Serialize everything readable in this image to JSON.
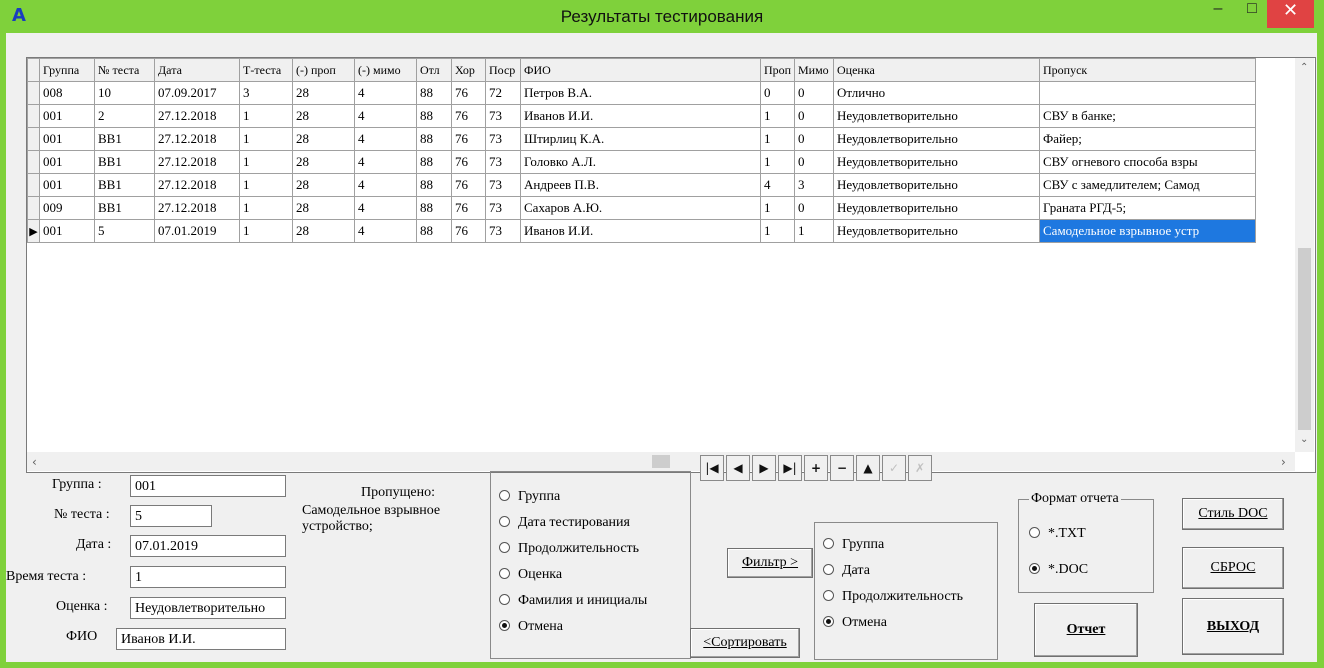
{
  "window": {
    "title": "Результаты тестирования",
    "icon": "app-logo-icon",
    "minimize": "–",
    "maximize": "□",
    "close": "✕"
  },
  "grid": {
    "columns": [
      "Группа",
      "№ теста",
      "Дата",
      "Т-теста",
      "(-) проп",
      "(-) мимо",
      "Отл",
      "Хор",
      "Поср",
      "ФИО",
      "Проп",
      "Мимо",
      "Оценка",
      "Пропуск"
    ],
    "rows": [
      [
        "008",
        "10",
        "07.09.2017",
        "3",
        "28",
        "4",
        "88",
        "76",
        "72",
        "Петров В.А.",
        "0",
        "0",
        "Отлично",
        ""
      ],
      [
        "001",
        "2",
        "27.12.2018",
        "1",
        "28",
        "4",
        "88",
        "76",
        "73",
        "Иванов И.И.",
        "1",
        "0",
        "Неудовлетворительно",
        "СВУ в банке;"
      ],
      [
        "001",
        "BB1",
        "27.12.2018",
        "1",
        "28",
        "4",
        "88",
        "76",
        "73",
        "Штирлиц К.А.",
        "1",
        "0",
        "Неудовлетворительно",
        "Файер;"
      ],
      [
        "001",
        "BB1",
        "27.12.2018",
        "1",
        "28",
        "4",
        "88",
        "76",
        "73",
        "Головко А.Л.",
        "1",
        "0",
        "Неудовлетворительно",
        "СВУ огневого способа взры"
      ],
      [
        "001",
        "BB1",
        "27.12.2018",
        "1",
        "28",
        "4",
        "88",
        "76",
        "73",
        "Андреев П.В.",
        "4",
        "3",
        "Неудовлетворительно",
        "СВУ с замедлителем; Самод"
      ],
      [
        "009",
        "BB1",
        "27.12.2018",
        "1",
        "28",
        "4",
        "88",
        "76",
        "73",
        "Сахаров А.Ю.",
        "1",
        "0",
        "Неудовлетворительно",
        "Граната РГД-5;"
      ],
      [
        "001",
        "5",
        "07.01.2019",
        "1",
        "28",
        "4",
        "88",
        "76",
        "73",
        "Иванов И.И.",
        "1",
        "1",
        "Неудовлетворительно",
        "Самодельное взрывное устр"
      ]
    ],
    "current_row_marker": "▶",
    "selection_color": "#1e78e0"
  },
  "details": {
    "group_label": "Группа :",
    "group_value": "001",
    "test_label": "№ теста :",
    "test_value": "5",
    "date_label": "Дата :",
    "date_value": "07.01.2019",
    "time_label": "Время теста :",
    "time_value": "1",
    "grade_label": "Оценка :",
    "grade_value": "Неудовлетворительно",
    "fio_label": "ФИО",
    "fio_value": "Иванов И.И.",
    "missed_title": "Пропущено:",
    "missed_text": "Самодельное взрывное устройство;"
  },
  "sort": {
    "options": [
      "Группа",
      "Дата тестирования",
      "Продолжительность",
      "Оценка",
      "Фамилия и инициалы",
      "Отмена"
    ],
    "selected": "Отмена",
    "button": "<Сортировать"
  },
  "filter": {
    "options": [
      "Группа",
      "Дата",
      "Продолжительность",
      "Отмена"
    ],
    "selected": "Отмена",
    "button": "Фильтр >"
  },
  "navigator": {
    "first": "|◀",
    "prior": "◀",
    "next": "▶",
    "last": "▶|",
    "insert": "+",
    "delete": "−",
    "edit": "▲",
    "post": "✓",
    "cancel": "✗"
  },
  "report_format": {
    "title": "Формат отчета",
    "options": [
      "*.TXT",
      "*.DOC"
    ],
    "selected": "*.DOC"
  },
  "buttons": {
    "style_doc": "Стиль DOC",
    "reset": "СБРОС",
    "report": "Отчет",
    "exit": "ВЫХОД"
  }
}
